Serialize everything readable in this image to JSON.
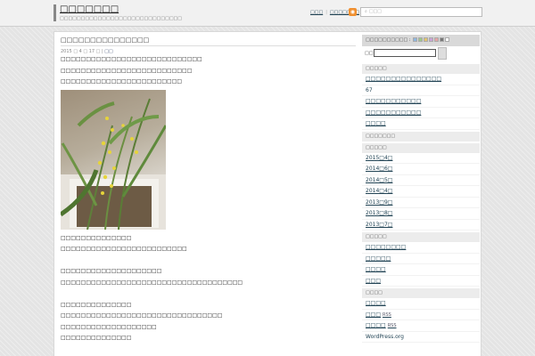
{
  "header": {
    "blog_title": "□□□□□□□",
    "blog_description": "□□□□□□□□□□□□□□□□□□□□□□□□□□□□□",
    "nav": [
      "□□□",
      "□□□□□□□"
    ],
    "search_placeholder": "□□□"
  },
  "post": {
    "title": "□□□□□□□□□□□□□□□",
    "meta_date": "2015 □ 4 □ 17 □",
    "meta_category": "□□",
    "lines_top": [
      "□□□□□□□□□□□□□□□□□□□□□□□□□□□□",
      "□□□□□□□□□□□□□□□□□□□□□□□□□□",
      "□□□□□□□□□□□□□□□□□□□□□□□□"
    ],
    "lines_bottom": [
      "□□□□□□□□□□□□□□",
      "□□□□□□□□□□□□□□□□□□□□□□□□□",
      "",
      "□□□□□□□□□□□□□□□□□□□□",
      "□□□□□□□□□□□□□□□□□□□□□□□□□□□□□□□□□□□□",
      "",
      "□□□□□□□□□□□□□□",
      "□□□□□□□□□□□□□□□□□□□□□□□□□□□□□□□□",
      "□□□□□□□□□□□□□□□□□□□",
      "□□□□□□□□□□□□□□"
    ]
  },
  "sidebar": {
    "theme_label": "□□□□□□□□□□ :",
    "swatches": [
      "#8fb7e0",
      "#9ec98a",
      "#e3c46e",
      "#c9a3d6",
      "#e4a6a6",
      "#777777",
      "#ffffff"
    ],
    "search_label": "□□",
    "sections": [
      {
        "heading": "□□□□□",
        "items": [
          {
            "label": "□□□□□□□□□□□□□□□",
            "link": true
          },
          {
            "label": "67",
            "link": false
          },
          {
            "label": "□□□□□□□□□□□",
            "link": true
          },
          {
            "label": "□□□□□□□□□□□",
            "link": true
          },
          {
            "label": "□□□□",
            "link": true
          }
        ]
      },
      {
        "heading": "□□□□□□□",
        "items": []
      },
      {
        "heading": "□□□□□",
        "items": [
          {
            "label": "2015□4□",
            "link": true
          },
          {
            "label": "2014□6□",
            "link": true
          },
          {
            "label": "2014□5□",
            "link": true
          },
          {
            "label": "2014□4□",
            "link": true
          },
          {
            "label": "2013□9□",
            "link": true
          },
          {
            "label": "2013□8□",
            "link": true
          },
          {
            "label": "2013□7□",
            "link": true
          }
        ]
      },
      {
        "heading": "□□□□□",
        "items": [
          {
            "label": "□□□□□□□□",
            "link": true
          },
          {
            "label": "□□□□□",
            "link": true
          },
          {
            "label": "□□□□",
            "link": true
          },
          {
            "label": "□□□",
            "link": true
          }
        ]
      },
      {
        "heading": "□□□□",
        "items": [
          {
            "label": "□□□□",
            "link": true
          },
          {
            "label": "□□□",
            "link": true,
            "tag": "RSS"
          },
          {
            "label": "□□□□",
            "link": true,
            "tag": "RSS"
          },
          {
            "label": "WordPress.org",
            "link": false
          }
        ]
      }
    ]
  }
}
